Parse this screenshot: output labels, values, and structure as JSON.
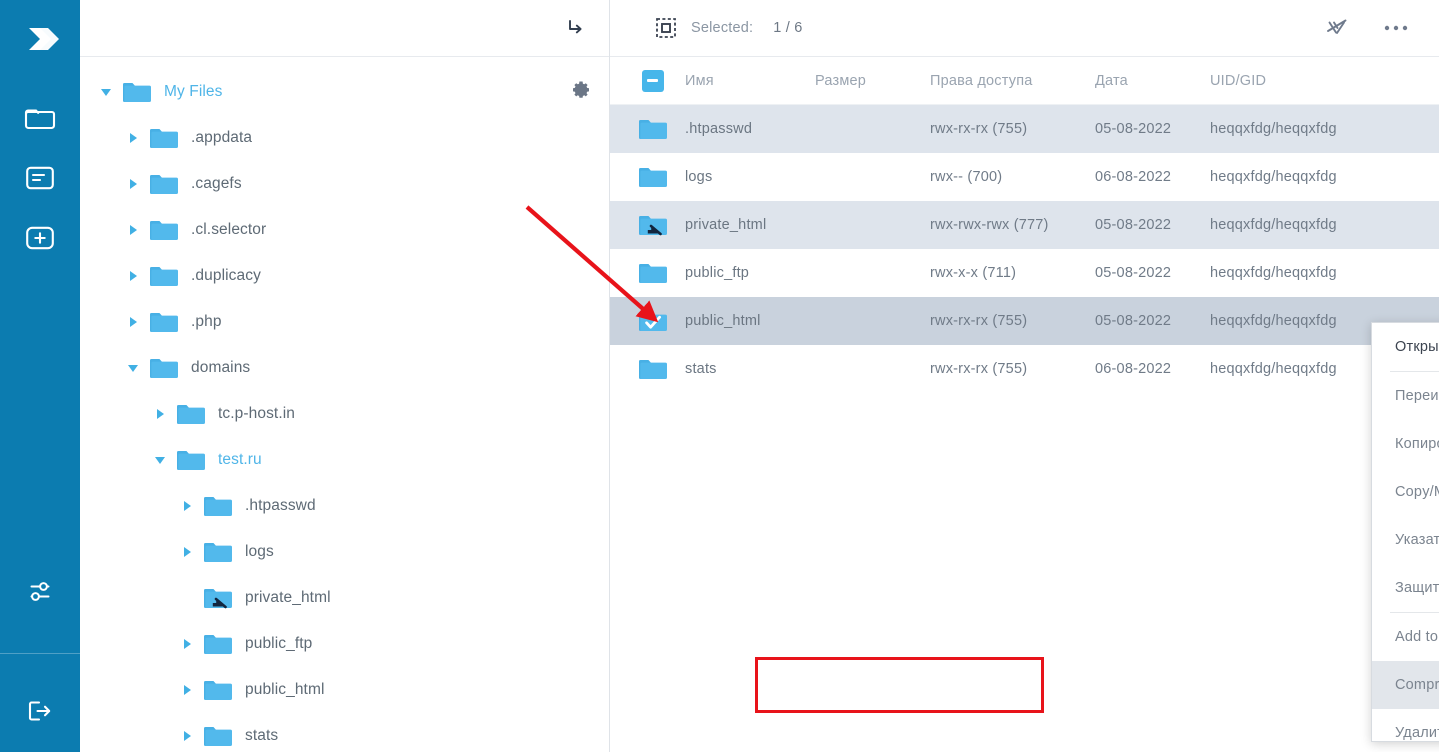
{
  "theme": {
    "rail_bg": "#0c7cb0",
    "accent": "#41b0e4",
    "folder_blue": "#52b9ec",
    "row_odd": "#dee4ec",
    "row_selected": "#c9d2dd",
    "annotation_red": "#e8131a"
  },
  "rail": {
    "logo_icon": "chevrons-right-logo-icon",
    "items": [
      {
        "icon": "folder-icon",
        "name": "file-manager"
      },
      {
        "icon": "document-icon",
        "name": "documents"
      },
      {
        "icon": "plus-box-icon",
        "name": "create-new"
      }
    ],
    "bottom_items": [
      {
        "icon": "sliders-icon",
        "name": "settings"
      },
      {
        "icon": "logout-icon",
        "name": "logout"
      }
    ]
  },
  "tree_panel": {
    "header_icon": "goto-arrow-icon",
    "gear_icon": "gear-icon",
    "nodes": [
      {
        "label": "My Files",
        "depth": 0,
        "state": "expanded",
        "accent": true,
        "icon": "folder-icon",
        "has_gear": true
      },
      {
        "label": ".appdata",
        "depth": 1,
        "state": "collapsed",
        "accent": false,
        "icon": "folder-icon",
        "has_gear": false
      },
      {
        "label": ".cagefs",
        "depth": 1,
        "state": "collapsed",
        "accent": false,
        "icon": "folder-icon",
        "has_gear": false
      },
      {
        "label": ".cl.selector",
        "depth": 1,
        "state": "collapsed",
        "accent": false,
        "icon": "folder-icon",
        "has_gear": false
      },
      {
        "label": ".duplicacy",
        "depth": 1,
        "state": "collapsed",
        "accent": false,
        "icon": "folder-icon",
        "has_gear": false
      },
      {
        "label": ".php",
        "depth": 1,
        "state": "collapsed",
        "accent": false,
        "icon": "folder-icon",
        "has_gear": false
      },
      {
        "label": "domains",
        "depth": 1,
        "state": "expanded",
        "accent": false,
        "icon": "folder-icon",
        "has_gear": false
      },
      {
        "label": "tc.p-host.in",
        "depth": 2,
        "state": "collapsed",
        "accent": false,
        "icon": "folder-icon",
        "has_gear": false
      },
      {
        "label": "test.ru",
        "depth": 2,
        "state": "expanded",
        "accent": true,
        "icon": "folder-icon",
        "has_gear": false
      },
      {
        "label": ".htpasswd",
        "depth": 3,
        "state": "collapsed",
        "accent": false,
        "icon": "folder-icon",
        "has_gear": false
      },
      {
        "label": "logs",
        "depth": 3,
        "state": "collapsed",
        "accent": false,
        "icon": "folder-icon",
        "has_gear": false
      },
      {
        "label": "private_html",
        "depth": 3,
        "state": "leaf",
        "accent": false,
        "icon": "folder-symlink-icon",
        "has_gear": false
      },
      {
        "label": "public_ftp",
        "depth": 3,
        "state": "collapsed",
        "accent": false,
        "icon": "folder-icon",
        "has_gear": false
      },
      {
        "label": "public_html",
        "depth": 3,
        "state": "collapsed",
        "accent": false,
        "icon": "folder-icon",
        "has_gear": false
      },
      {
        "label": "stats",
        "depth": 3,
        "state": "collapsed",
        "accent": false,
        "icon": "folder-icon",
        "has_gear": false
      }
    ]
  },
  "file_panel": {
    "toolbar": {
      "selection_icon": "selection-box-icon",
      "selected_label": "Selected:",
      "selected_count": "1 / 6",
      "deselect_icon": "deselect-all-icon",
      "more_icon": "more-options-icon"
    },
    "columns": [
      "Имя",
      "Размер",
      "Права доступа",
      "Дата",
      "UID/GID"
    ],
    "select_all_state": "indeterminate",
    "rows": [
      {
        "name": ".htpasswd",
        "size": "",
        "perm": "rwx-rx-rx (755)",
        "date": "05-08-2022",
        "uid": "heqqxfdg/heqqxfdg",
        "icon": "folder-icon",
        "selected": false,
        "shaded": true
      },
      {
        "name": "logs",
        "size": "",
        "perm": "rwx-- (700)",
        "date": "06-08-2022",
        "uid": "heqqxfdg/heqqxfdg",
        "icon": "folder-icon",
        "selected": false,
        "shaded": false
      },
      {
        "name": "private_html",
        "size": "",
        "perm": "rwx-rwx-rwx (777)",
        "date": "05-08-2022",
        "uid": "heqqxfdg/heqqxfdg",
        "icon": "folder-symlink-icon",
        "selected": false,
        "shaded": true
      },
      {
        "name": "public_ftp",
        "size": "",
        "perm": "rwx-x-x (711)",
        "date": "05-08-2022",
        "uid": "heqqxfdg/heqqxfdg",
        "icon": "folder-icon",
        "selected": false,
        "shaded": false
      },
      {
        "name": "public_html",
        "size": "",
        "perm": "rwx-rx-rx (755)",
        "date": "05-08-2022",
        "uid": "heqqxfdg/heqqxfdg",
        "icon": "folder-checked-icon",
        "selected": true,
        "shaded": true
      },
      {
        "name": "stats",
        "size": "",
        "perm": "rwx-rx-rx (755)",
        "date": "06-08-2022",
        "uid": "heqqxfdg/heqqxfdg",
        "icon": "folder-icon",
        "selected": false,
        "shaded": false
      }
    ]
  },
  "context_menu": {
    "items": [
      {
        "label": "Открыть",
        "strong": true,
        "highlight": false,
        "sep_after": true
      },
      {
        "label": "Переименовать",
        "strong": false,
        "highlight": false,
        "sep_after": false
      },
      {
        "label": "Копировать",
        "strong": false,
        "highlight": false,
        "sep_after": false
      },
      {
        "label": "Copy/Move to...",
        "strong": false,
        "highlight": false,
        "sep_after": false
      },
      {
        "label": "Указать права доступа",
        "strong": false,
        "highlight": false,
        "sep_after": false
      },
      {
        "label": "Защитить",
        "strong": false,
        "highlight": false,
        "sep_after": true
      },
      {
        "label": "Add to archive",
        "strong": false,
        "highlight": false,
        "sep_after": false
      },
      {
        "label": "Compress and download",
        "strong": false,
        "highlight": true,
        "sep_after": false
      },
      {
        "label": "Удалить",
        "strong": false,
        "highlight": false,
        "sep_after": false
      }
    ],
    "scrollbar": {
      "up_icon": "scroll-up-arrow-icon",
      "down_icon": "scroll-down-arrow-icon"
    }
  },
  "annotations": {
    "arrow": {
      "name": "red-pointer-arrow",
      "from": "527,207",
      "to": "656,321"
    },
    "box": {
      "name": "red-highlight-box",
      "target": "Compress and download"
    }
  }
}
